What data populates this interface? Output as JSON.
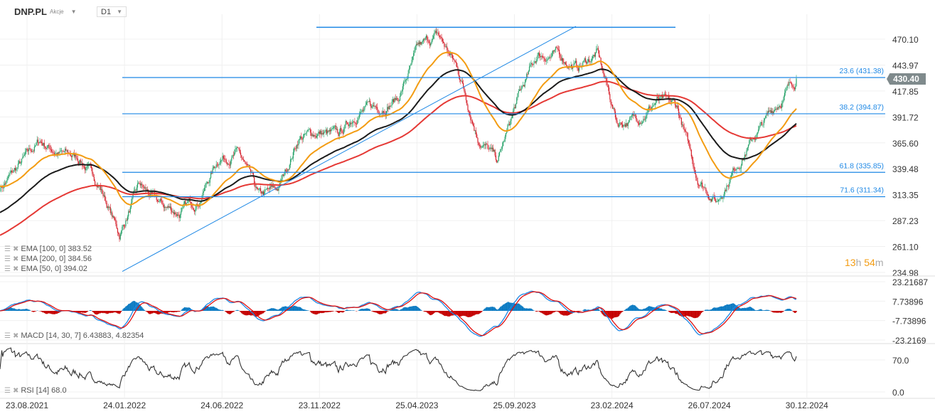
{
  "header": {
    "symbol": "DNP.PL",
    "asset_class": "Akcje",
    "timeframe": "D1"
  },
  "timer": {
    "hours": "13",
    "h": "h",
    "minutes": "54",
    "m": "m"
  },
  "legend": {
    "ema100": "EMA [100, 0] 383.52",
    "ema200": "EMA [200, 0] 384.56",
    "ema50": "EMA [50, 0] 394.02",
    "macd": "MACD [14, 30, 7] 6.43883,  4.82354",
    "rsi": "RSI [14] 68.0"
  },
  "colors": {
    "up": "#26a269",
    "down": "#d6212c",
    "ema50": "#f39c12",
    "ema100": "#1b1b1b",
    "ema200": "#e53935",
    "fib": "#1e88e5",
    "macd": "#1e88e5",
    "signal": "#e01010",
    "hist_up": "#0b7ac2",
    "hist_down": "#c40000",
    "rsi": "#333333"
  },
  "chart_data": {
    "type": "candlestick",
    "price_axis": {
      "ticks": [
        "470.10",
        "443.97",
        "417.85",
        "391.72",
        "365.60",
        "339.48",
        "313.35",
        "287.23",
        "261.10",
        "234.98"
      ],
      "range": [
        234.98,
        470.1
      ]
    },
    "last_price": "430.40",
    "date_ticks": [
      "23.08.2021",
      "24.01.2022",
      "24.06.2022",
      "23.11.2022",
      "25.04.2023",
      "25.09.2023",
      "23.02.2024",
      "26.07.2024",
      "30.12.2024"
    ],
    "monthly_close_approx": [
      320,
      343,
      367,
      355,
      350,
      323,
      273,
      322,
      303,
      295,
      309,
      351,
      355,
      310,
      319,
      371,
      376,
      372,
      398,
      401,
      411,
      459,
      474,
      440,
      373,
      346,
      409,
      454,
      454,
      441,
      456,
      386,
      390,
      408,
      401,
      332,
      307,
      344,
      375,
      404,
      430.4
    ],
    "ema_start": {
      "ema50": 322,
      "ema100": 295,
      "ema200": 272
    },
    "fibonacci": [
      {
        "label": "23.6 (431.38)",
        "value": 431.38
      },
      {
        "label": "38.2 (394.87)",
        "value": 394.87
      },
      {
        "label": "61.8 (335.85)",
        "value": 335.85
      },
      {
        "label": "71.6 (311.34)",
        "value": 311.34
      }
    ],
    "resistance_line": 482,
    "trendline": {
      "from": 236,
      "to": 483
    },
    "macd_axis": {
      "ticks": [
        "23.21687",
        "7.73896",
        "-7.73896",
        "-23.2169"
      ],
      "range": [
        -23.2169,
        23.21687
      ]
    },
    "rsi_axis": {
      "ticks": [
        "70.0",
        "0.0"
      ],
      "range": [
        0,
        100
      ]
    }
  }
}
